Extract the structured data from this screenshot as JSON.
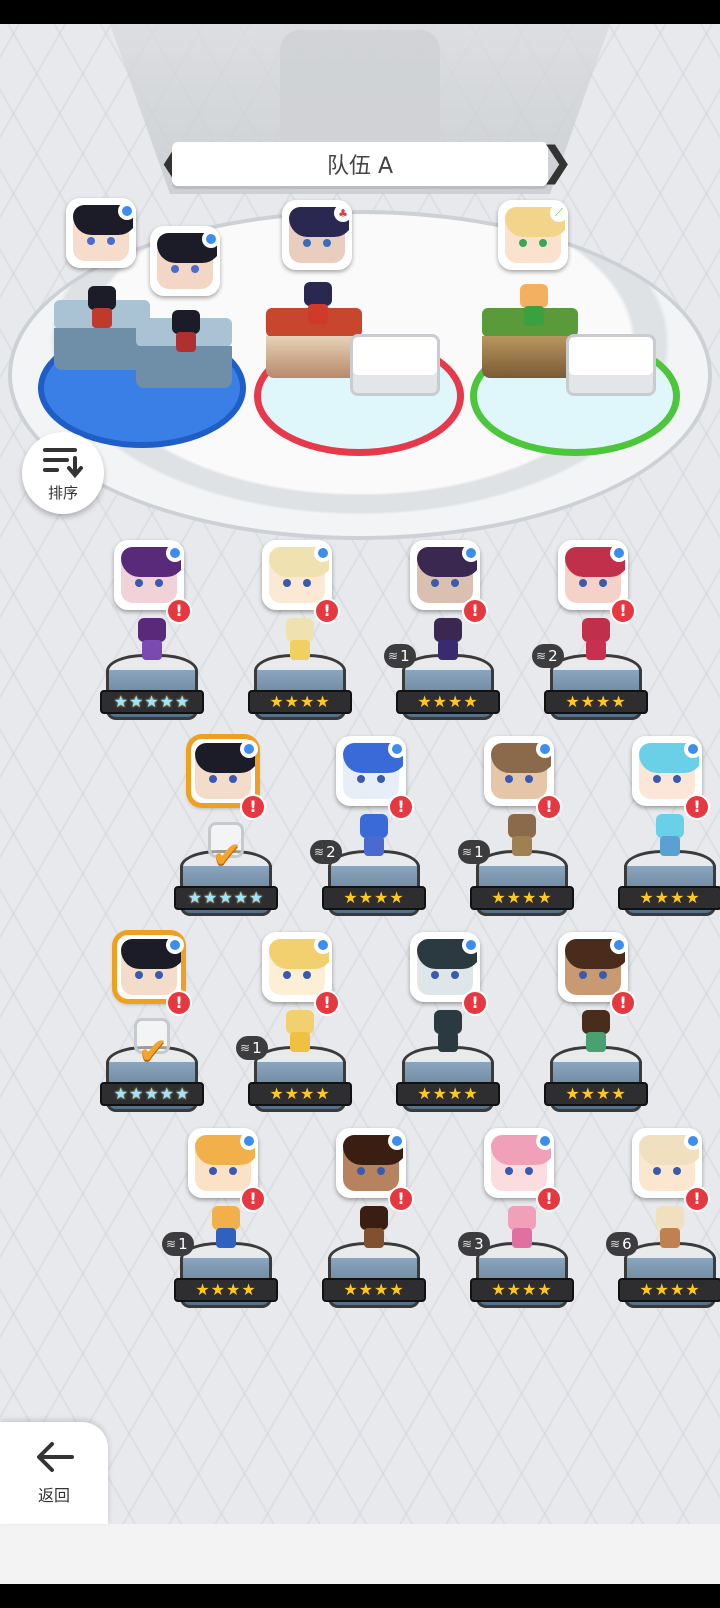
{
  "team": {
    "title": "队伍 A"
  },
  "buttons": {
    "sort": "排序",
    "back": "返回"
  },
  "team_slots": [
    {
      "slot": 1,
      "element": "blue-dot",
      "ring_color": "#1f5ec6"
    },
    {
      "slot": 2,
      "element": "red-flame",
      "ring_color": "#e6394b"
    },
    {
      "slot": 3,
      "element": "green-leaf",
      "ring_color": "#4cc63b"
    }
  ],
  "roster": [
    {
      "stars": "★★★★★",
      "rainbow": true,
      "badge": ""
    },
    {
      "stars": "★★★★",
      "rainbow": false,
      "badge": ""
    },
    {
      "stars": "★★★★",
      "rainbow": false,
      "badge": "1"
    },
    {
      "stars": "★★★★",
      "rainbow": false,
      "badge": "2"
    },
    {
      "stars": "★★★★★",
      "rainbow": true,
      "badge": "",
      "selected": true
    },
    {
      "stars": "★★★★",
      "rainbow": false,
      "badge": "2"
    },
    {
      "stars": "★★★★",
      "rainbow": false,
      "badge": "1"
    },
    {
      "stars": "★★★★",
      "rainbow": false,
      "badge": ""
    },
    {
      "stars": "★★★★★",
      "rainbow": true,
      "badge": "",
      "selected": true
    },
    {
      "stars": "★★★★",
      "rainbow": false,
      "badge": "1"
    },
    {
      "stars": "★★★★",
      "rainbow": false,
      "badge": ""
    },
    {
      "stars": "★★★★",
      "rainbow": false,
      "badge": ""
    },
    {
      "stars": "★★★★",
      "rainbow": false,
      "badge": "1"
    },
    {
      "stars": "★★★★",
      "rainbow": false,
      "badge": ""
    },
    {
      "stars": "★★★★",
      "rainbow": false,
      "badge": "3"
    },
    {
      "stars": "★★★★",
      "rainbow": false,
      "badge": "6"
    }
  ],
  "alert_symbol": "!",
  "icons": {
    "sort": "sort-icon",
    "back": "back-arrow-icon",
    "check": "checkmark-icon"
  }
}
